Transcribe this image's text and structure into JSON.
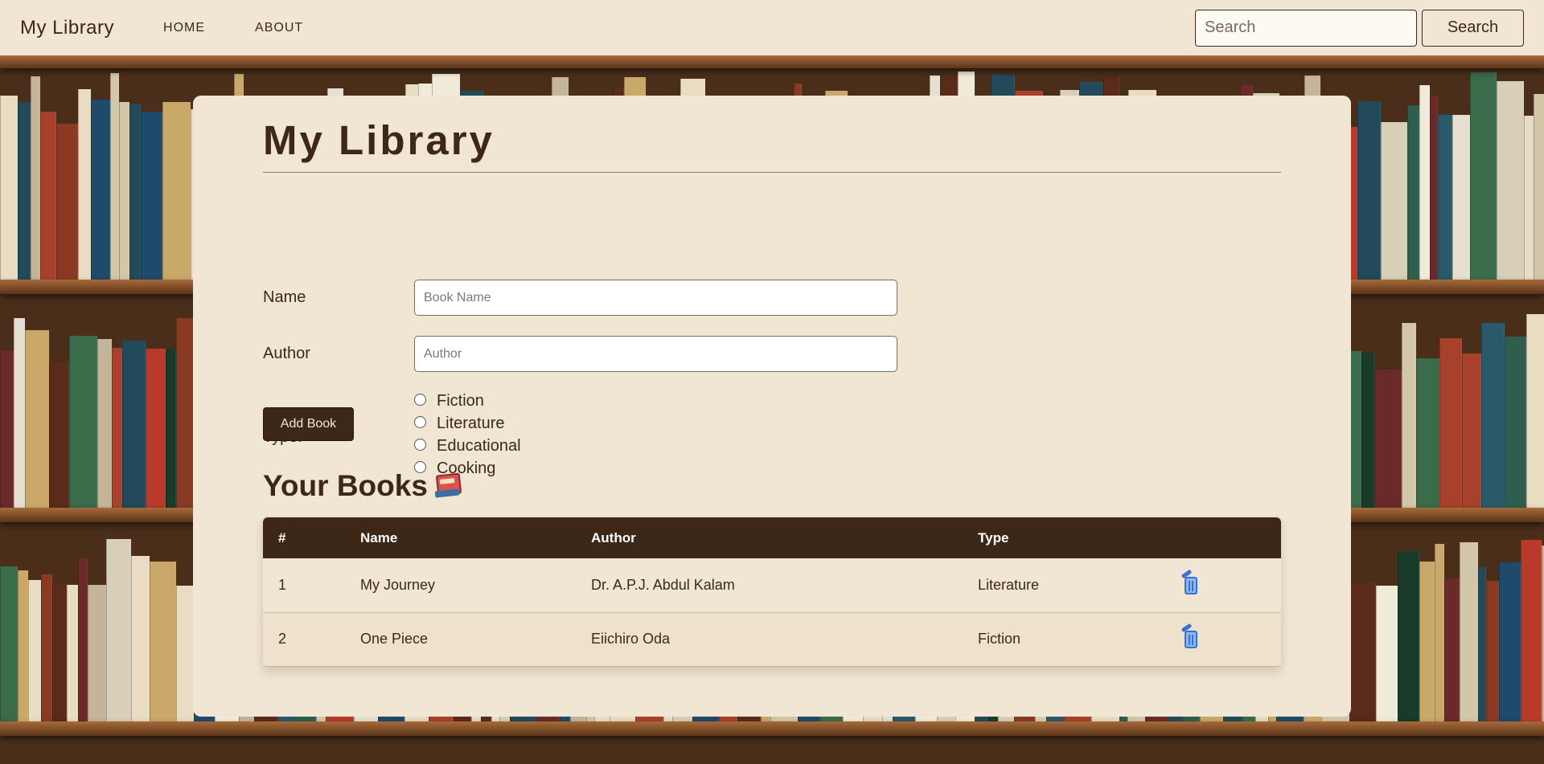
{
  "navbar": {
    "brand": "My Library",
    "links": [
      "HOME",
      "ABOUT"
    ],
    "search_placeholder": "Search",
    "search_button": "Search"
  },
  "main": {
    "title": "My Library",
    "form": {
      "name_label": "Name",
      "name_placeholder": "Book Name",
      "author_label": "Author",
      "author_placeholder": "Author",
      "type_label": "Type:",
      "types": [
        "Fiction",
        "Literature",
        "Educational",
        "Cooking"
      ],
      "add_button": "Add Book"
    },
    "books_section": {
      "title": "Your Books",
      "icon": "books-icon",
      "columns": [
        "#",
        "Name",
        "Author",
        "Type",
        ""
      ],
      "rows": [
        {
          "num": "1",
          "name": "My Journey",
          "author": "Dr. A.P.J. Abdul Kalam",
          "type": "Literature",
          "action_icon": "trash-icon"
        },
        {
          "num": "2",
          "name": "One Piece",
          "author": "Eiichiro Oda",
          "type": "Fiction",
          "action_icon": "trash-icon"
        }
      ]
    }
  },
  "colors": {
    "primary": "#3d2817",
    "surface": "#f1e6d3",
    "trash_accent": "#3b6fd6"
  }
}
